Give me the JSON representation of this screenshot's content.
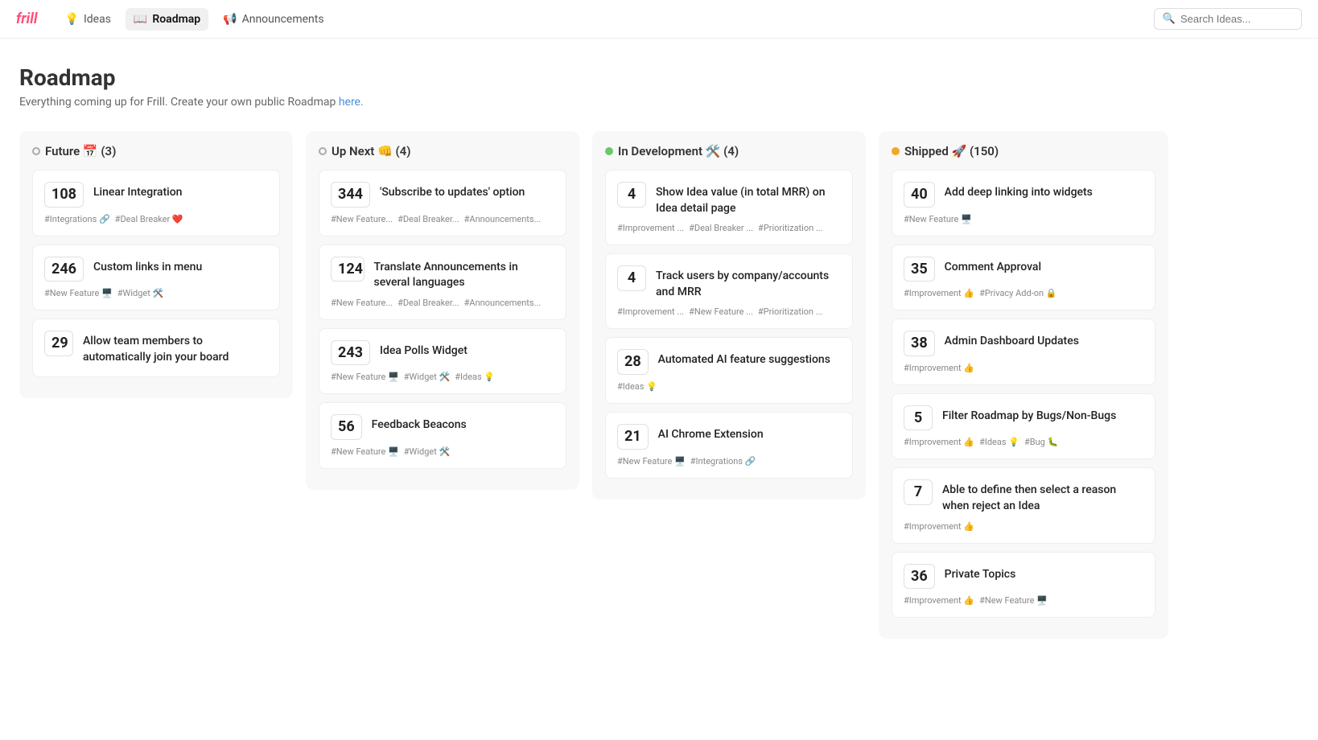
{
  "nav": {
    "logo": "frill",
    "items": [
      {
        "id": "ideas",
        "label": "Ideas",
        "icon": "💡",
        "active": false
      },
      {
        "id": "roadmap",
        "label": "Roadmap",
        "icon": "📖",
        "active": true
      },
      {
        "id": "announcements",
        "label": "Announcements",
        "icon": "📢",
        "active": false
      }
    ],
    "search_placeholder": "Search Ideas..."
  },
  "page": {
    "title": "Roadmap",
    "subtitle": "Everything coming up for Frill. Create your own public Roadmap ",
    "subtitle_link": "here.",
    "subtitle_link_url": "#"
  },
  "columns": [
    {
      "id": "future",
      "title": "Future",
      "icon": "📅",
      "count": 3,
      "dot_class": "col-dot-future",
      "cards": [
        {
          "number": "108",
          "title": "Linear Integration",
          "tags": [
            "#Integrations 🔗",
            "#Deal Breaker ❤️"
          ]
        },
        {
          "number": "246",
          "title": "Custom links in menu",
          "tags": [
            "#New Feature 🖥️",
            "#Widget 🛠️"
          ]
        },
        {
          "number": "29",
          "title": "Allow team members to automatically join your board",
          "tags": []
        }
      ]
    },
    {
      "id": "upnext",
      "title": "Up Next",
      "icon": "👊",
      "count": 4,
      "dot_class": "col-dot-upnext",
      "cards": [
        {
          "number": "344",
          "title": "'Subscribe to updates' option",
          "tags": [
            "#New Feature...",
            "#Deal Breaker...",
            "#Announcements..."
          ]
        },
        {
          "number": "124",
          "title": "Translate Announcements in several languages",
          "tags": [
            "#New Feature...",
            "#Deal Breaker...",
            "#Announcements..."
          ]
        },
        {
          "number": "243",
          "title": "Idea Polls Widget",
          "tags": [
            "#New Feature 🖥️",
            "#Widget 🛠️",
            "#Ideas 💡"
          ]
        },
        {
          "number": "56",
          "title": "Feedback Beacons",
          "tags": [
            "#New Feature 🖥️",
            "#Widget 🛠️"
          ]
        }
      ]
    },
    {
      "id": "indev",
      "title": "In Development",
      "icon": "🛠️",
      "count": 4,
      "dot_class": "col-dot-indev",
      "cards": [
        {
          "number": "4",
          "title": "Show Idea value (in total MRR) on Idea detail page",
          "tags": [
            "#Improvement ...",
            "#Deal Breaker ...",
            "#Prioritization ..."
          ]
        },
        {
          "number": "4",
          "title": "Track users by company/accounts and MRR",
          "tags": [
            "#Improvement ...",
            "#New Feature ...",
            "#Prioritization ..."
          ]
        },
        {
          "number": "28",
          "title": "Automated AI feature suggestions",
          "tags": [
            "#Ideas 💡"
          ]
        },
        {
          "number": "21",
          "title": "AI Chrome Extension",
          "tags": [
            "#New Feature 🖥️",
            "#Integrations 🔗"
          ]
        }
      ]
    },
    {
      "id": "shipped",
      "title": "Shipped",
      "icon": "🚀",
      "count": 150,
      "dot_class": "col-dot-shipped",
      "cards": [
        {
          "number": "40",
          "title": "Add deep linking into widgets",
          "tags": [
            "#New Feature 🖥️"
          ]
        },
        {
          "number": "35",
          "title": "Comment Approval",
          "tags": [
            "#Improvement 👍",
            "#Privacy Add-on 🔒"
          ]
        },
        {
          "number": "38",
          "title": "Admin Dashboard Updates",
          "tags": [
            "#Improvement 👍"
          ]
        },
        {
          "number": "5",
          "title": "Filter Roadmap by Bugs/Non-Bugs",
          "tags": [
            "#Improvement 👍",
            "#Ideas 💡",
            "#Bug 🐛"
          ]
        },
        {
          "number": "7",
          "title": "Able to define then select a reason when reject an Idea",
          "tags": [
            "#Improvement 👍"
          ]
        },
        {
          "number": "36",
          "title": "Private Topics",
          "tags": [
            "#Improvement 👍",
            "#New Feature 🖥️"
          ]
        }
      ]
    }
  ]
}
